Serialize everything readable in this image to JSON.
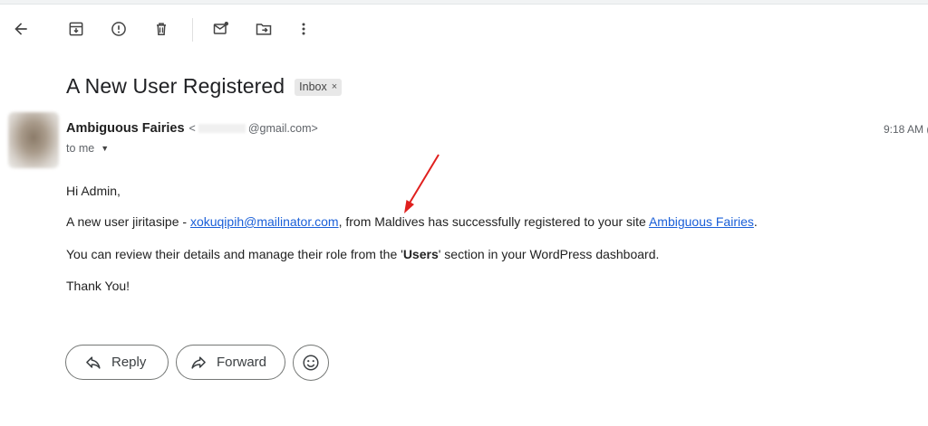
{
  "toolbar": {
    "back": "back-arrow-icon",
    "archive": "archive-icon",
    "spam": "report-spam-icon",
    "delete": "trash-icon",
    "unread": "mark-unread-icon",
    "move": "move-to-icon",
    "more": "more-vert-icon"
  },
  "email": {
    "subject": "A New User Registered",
    "label": "Inbox",
    "label_remove": "×",
    "sender_name": "Ambiguous Fairies",
    "sender_email_prefix": "<",
    "sender_email_domain": "@gmail.com>",
    "time": "9:18 AM (",
    "to": "to me",
    "caret": "▼",
    "body": {
      "greeting": "Hi Admin,",
      "line1_pre": "A new user jiritasipe - ",
      "line1_email": "xokuqipih@mailinator.com",
      "line1_mid": ", from Maldives has successfully registered to your site ",
      "line1_site": "Ambiguous Fairies",
      "line1_end": ".",
      "line2_pre": "You can review their details and manage their role from the '",
      "line2_bold": "Users",
      "line2_post": "' section in your WordPress dashboard.",
      "signoff": "Thank You!"
    }
  },
  "actions": {
    "reply": "Reply",
    "forward": "Forward",
    "emoji": "emoji-icon"
  },
  "colors": {
    "link": "#1a5fd8",
    "annotation_arrow": "#e0201e"
  }
}
